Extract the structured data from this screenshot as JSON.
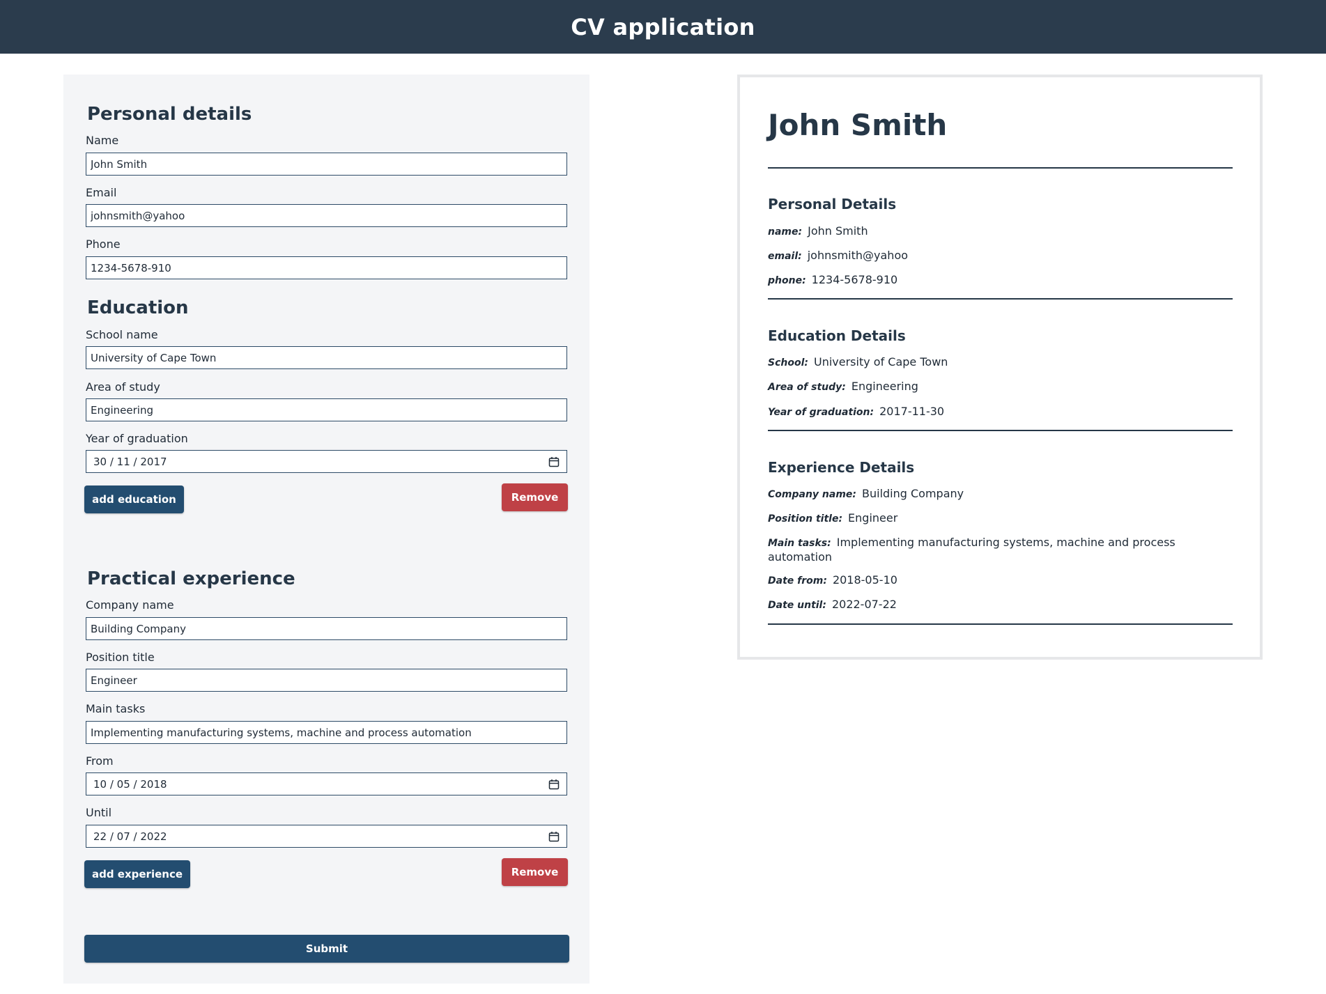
{
  "header": {
    "title": "CV application"
  },
  "form": {
    "personal": {
      "title": "Personal details",
      "name_label": "Name",
      "name_value": "John Smith",
      "email_label": "Email",
      "email_value": "johnsmith@yahoo",
      "phone_label": "Phone",
      "phone_value": "1234-5678-910"
    },
    "education": {
      "title": "Education",
      "school_label": "School name",
      "school_value": "University of Cape Town",
      "area_label": "Area of study",
      "area_value": "Engineering",
      "year_label": "Year of graduation",
      "year_value": "30 / 11 / 2017",
      "add_label": "add education",
      "remove_label": "Remove"
    },
    "experience": {
      "title": "Practical experience",
      "company_label": "Company name",
      "company_value": "Building Company",
      "position_label": "Position title",
      "position_value": "Engineer",
      "tasks_label": "Main tasks",
      "tasks_value": "Implementing manufacturing systems, machine and process automation",
      "from_label": "From",
      "from_value": "10 / 05 / 2018",
      "until_label": "Until",
      "until_value": "22 / 07 / 2022",
      "add_label": "add experience",
      "remove_label": "Remove"
    },
    "submit_label": "Submit"
  },
  "preview": {
    "name": "John Smith",
    "personal": {
      "heading": "Personal Details",
      "name_key": "name:",
      "name_val": "John Smith",
      "email_key": "email:",
      "email_val": "johnsmith@yahoo",
      "phone_key": "phone:",
      "phone_val": "1234-5678-910"
    },
    "education": {
      "heading": "Education Details",
      "school_key": "School:",
      "school_val": "University of Cape Town",
      "area_key": "Area of study:",
      "area_val": "Engineering",
      "year_key": "Year of graduation:",
      "year_val": "2017-11-30"
    },
    "experience": {
      "heading": "Experience Details",
      "company_key": "Company name:",
      "company_val": "Building Company",
      "position_key": "Position title:",
      "position_val": "Engineer",
      "tasks_key": "Main tasks:",
      "tasks_val": "Implementing manufacturing systems, machine and process automation",
      "from_key": "Date from:",
      "from_val": "2018-05-10",
      "until_key": "Date until:",
      "until_val": "2022-07-22"
    }
  },
  "colors": {
    "header_bg": "#2b3c4d",
    "primary": "#234d70",
    "danger": "#bf4146",
    "panel_bg": "#f4f5f7"
  }
}
